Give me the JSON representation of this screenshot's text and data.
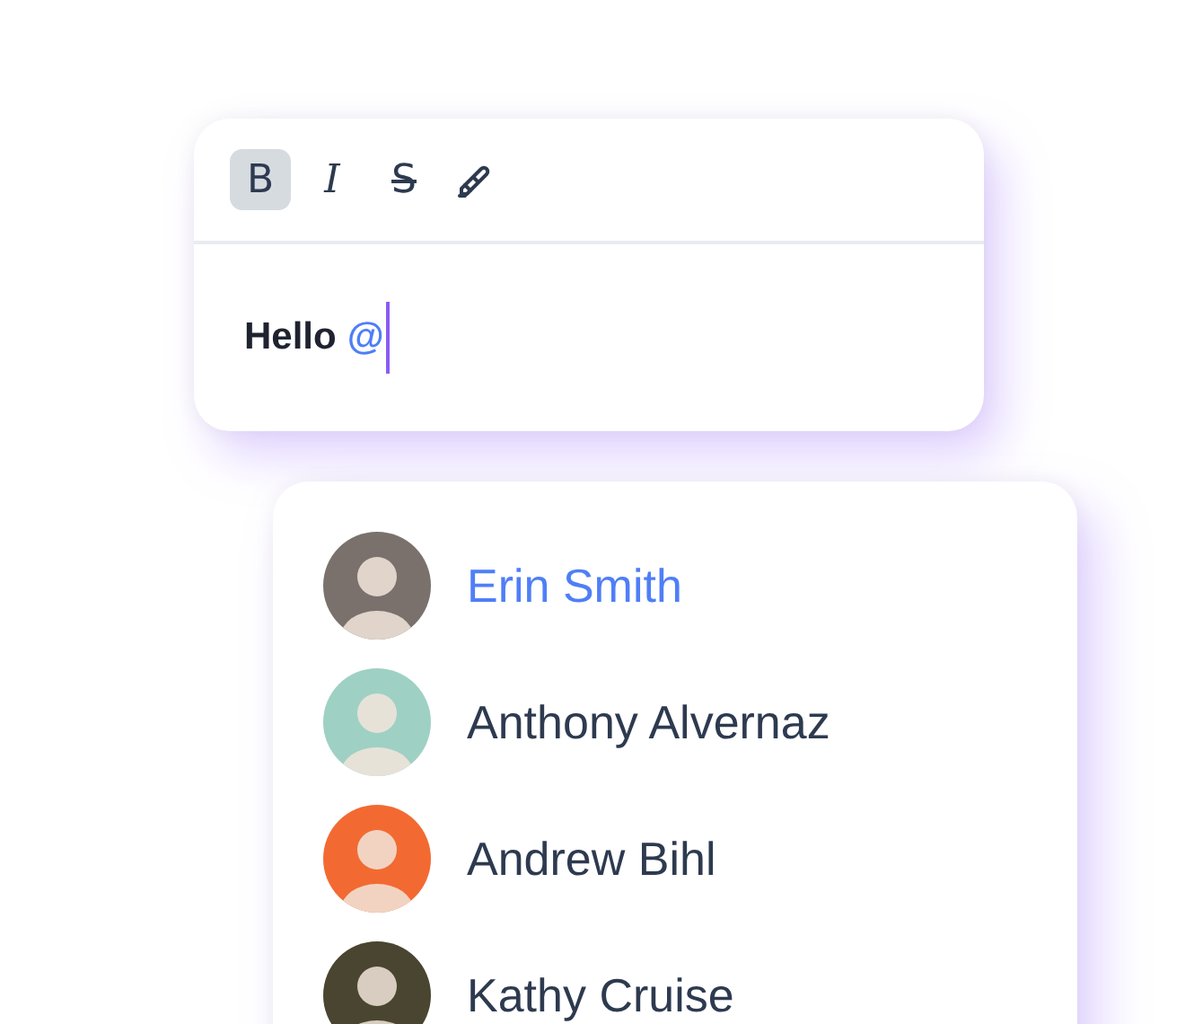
{
  "toolbar": [
    {
      "kind": "bold",
      "label": "B",
      "active": true
    },
    {
      "kind": "italic",
      "label": "I",
      "active": false
    },
    {
      "kind": "strike",
      "label": "S",
      "active": false
    },
    {
      "kind": "highlight",
      "active": false
    }
  ],
  "editor": {
    "text": "Hello",
    "mention": "@"
  },
  "suggestions": [
    {
      "name": "Erin Smith",
      "selected": true,
      "color": "#7a716c"
    },
    {
      "name": "Anthony Alvernaz",
      "selected": false,
      "color": "#9fd0c4"
    },
    {
      "name": "Andrew Bihl",
      "selected": false,
      "color": "#f26a32"
    },
    {
      "name": "Kathy Cruise",
      "selected": false,
      "color": "#4a4530"
    }
  ]
}
